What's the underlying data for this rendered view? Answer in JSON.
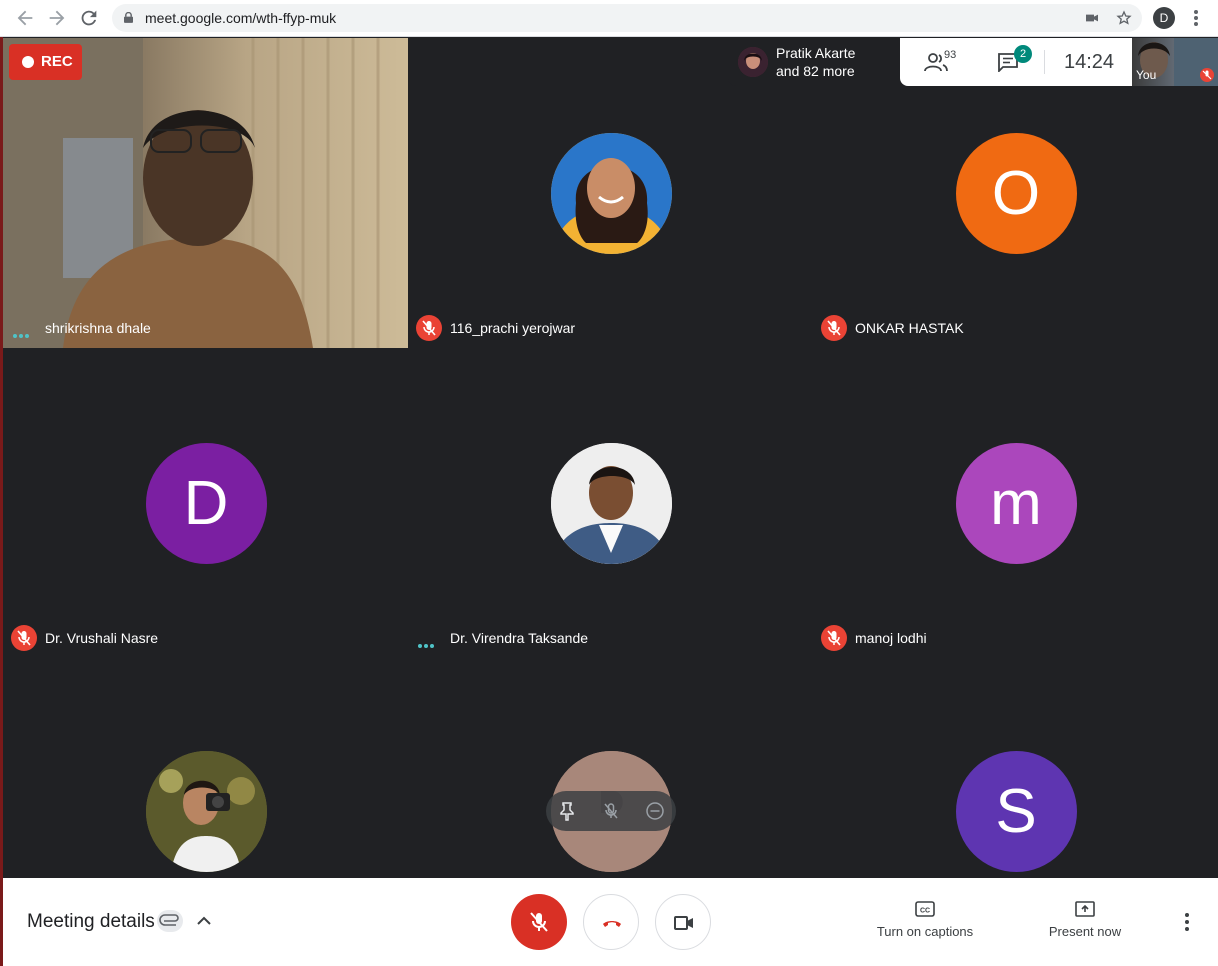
{
  "browser": {
    "url": "meet.google.com/wth-ffyp-muk",
    "profile_initial": "D",
    "back_icon": "arrow-left-icon",
    "forward_icon": "arrow-right-icon",
    "reload_icon": "reload-icon"
  },
  "recording": {
    "label": "REC",
    "color": "#d93025"
  },
  "presence": {
    "line1": "Pratik Akarte",
    "line2": "and 82 more"
  },
  "info": {
    "participant_count": "93",
    "unread_messages": "2",
    "time": "14:24",
    "self_label": "You"
  },
  "tiles": [
    {
      "name": "shrikrishna dhale",
      "type": "video",
      "audio": "speaking"
    },
    {
      "name": "116_prachi yerojwar",
      "type": "photo",
      "audio": "muted"
    },
    {
      "name": "ONKAR HASTAK",
      "type": "initial",
      "initial": "O",
      "color": "#f06a12",
      "audio": "muted"
    },
    {
      "name": "Dr. Vrushali Nasre",
      "type": "initial",
      "initial": "D",
      "color": "#7b1fa2",
      "audio": "muted"
    },
    {
      "name": "Dr. Virendra Taksande",
      "type": "photo",
      "audio": "speaking"
    },
    {
      "name": "manoj lodhi",
      "type": "initial",
      "initial": "m",
      "color": "#ab47bc",
      "audio": "muted"
    },
    {
      "name": "",
      "type": "photo",
      "audio": "none"
    },
    {
      "name": "",
      "type": "photo",
      "audio": "none"
    },
    {
      "name": "",
      "type": "initial",
      "initial": "S",
      "color": "#5e35b1",
      "audio": "none"
    }
  ],
  "bottom": {
    "meeting_details": "Meeting details",
    "captions_label": "Turn on captions",
    "present_label": "Present now"
  },
  "colors": {
    "stage": "#202124",
    "accent_red": "#d93025",
    "chat_badge": "#00897b"
  }
}
